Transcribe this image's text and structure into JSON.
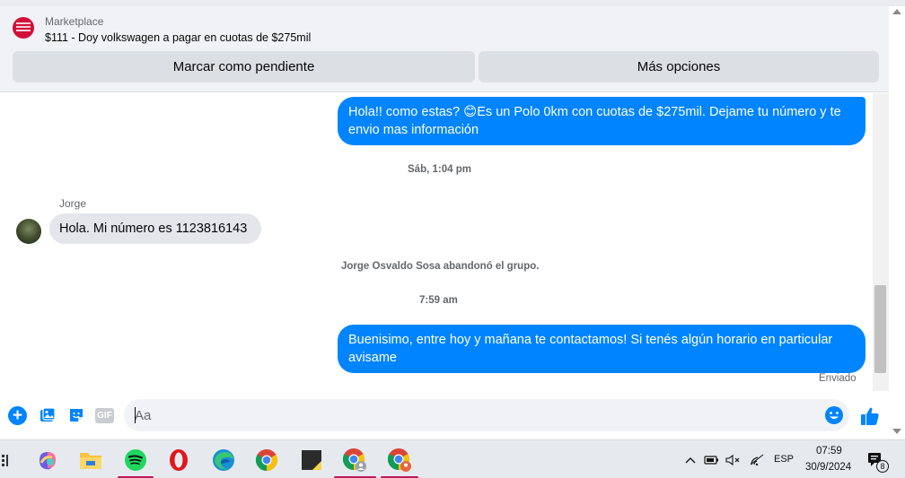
{
  "header": {
    "category": "Marketplace",
    "listing_title": "$111 - Doy volkswagen a pagar en cuotas de $275mil",
    "btn_pending": "Marcar como pendiente",
    "btn_more": "Más opciones"
  },
  "messages": {
    "out_1": "Hola!! como estas? 😊Es un Polo 0km con cuotas de $275mil. Dejame tu número y te envio mas información",
    "ts_1": "Sáb, 1:04 pm",
    "sender_name": "Jorge",
    "in_1": "Hola. Mi número es 1123816143",
    "system_msg": "Jorge Osvaldo Sosa abandonó el grupo.",
    "ts_2": "7:59 am",
    "out_2": "Buenisimo, entre hoy y mañana te contactamos! Si tenés algún horario en particular avisame",
    "status": "Enviado"
  },
  "composer": {
    "placeholder": "Aa",
    "gif_label": "GIF",
    "plus_symbol": "+"
  },
  "taskbar": {
    "lang": "ESP",
    "time": "07:59",
    "date": "30/9/2024",
    "notification_count": "8"
  },
  "colors": {
    "accent_blue": "#0084ff",
    "incoming_bubble": "#e4e6eb",
    "header_bg": "#f0f2f5"
  }
}
